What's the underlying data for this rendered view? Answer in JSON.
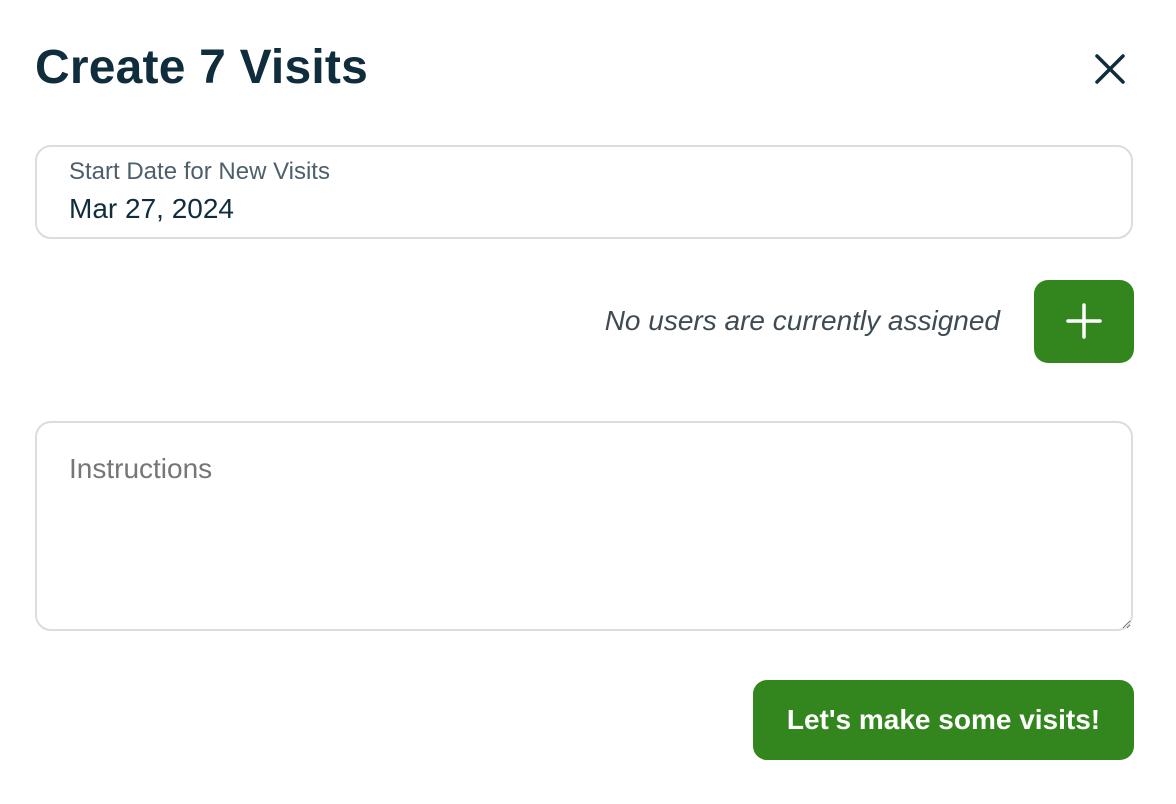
{
  "header": {
    "title": "Create 7 Visits",
    "close_icon": "close-icon"
  },
  "start_date": {
    "label": "Start Date for New Visits",
    "value": "Mar 27, 2024"
  },
  "assignment": {
    "status_text": "No users are currently assigned",
    "add_icon": "plus-icon"
  },
  "instructions": {
    "placeholder": "Instructions",
    "value": ""
  },
  "actions": {
    "submit_label": "Let's make some visits!"
  },
  "colors": {
    "primary_green": "#33861e",
    "title_text": "#0f2d3c",
    "border": "#dcdcdc"
  }
}
